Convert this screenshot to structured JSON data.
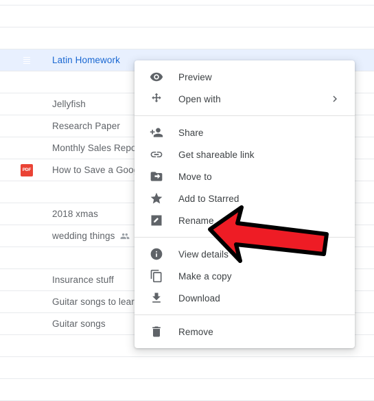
{
  "app": {
    "name": "Google Drive file list with context menu"
  },
  "colors": {
    "selected_row_bg": "#e8f0fe",
    "selected_row_text": "#1967d2",
    "row_text": "#5f6368",
    "menu_text": "#3c4043",
    "menu_icon": "#5f6368",
    "divider": "#e8eaed",
    "sheet_green": "#0f9d58",
    "doc_blue": "#4285f4",
    "slides_yellow": "#f4b400",
    "pdf_red": "#ea4335",
    "arrow_red": "#ee1c25",
    "arrow_outline": "#000000"
  },
  "file_list": {
    "rows": [
      {
        "icon": "sheets-file-icon",
        "icon_type": "sheet",
        "name": "",
        "selected": false,
        "partial": true,
        "shared": false
      },
      {
        "icon": "sheets-file-icon",
        "icon_type": "sheet",
        "name": "",
        "selected": false,
        "partial": false,
        "shared": false
      },
      {
        "icon": "sheets-file-icon",
        "icon_type": "sheet",
        "name": "",
        "selected": false,
        "partial": false,
        "shared": false
      },
      {
        "icon": "docs-file-icon",
        "icon_type": "doc",
        "name": "Latin Homework",
        "selected": true,
        "partial": false,
        "shared": false
      },
      {
        "icon": "sheets-file-icon",
        "icon_type": "sheet",
        "name": "",
        "selected": false,
        "partial": false,
        "shared": false
      },
      {
        "icon": "slides-file-icon",
        "icon_type": "slides",
        "name": "Jellyfish",
        "selected": false,
        "partial": false,
        "shared": false
      },
      {
        "icon": "docs-file-icon",
        "icon_type": "doc",
        "name": "Research Paper",
        "selected": false,
        "partial": false,
        "shared": false
      },
      {
        "icon": "sheets-file-icon",
        "icon_type": "sheet",
        "name": "Monthly Sales Report",
        "selected": false,
        "partial": false,
        "shared": false
      },
      {
        "icon": "pdf-file-icon",
        "icon_type": "pdf",
        "name": "How to Save a Google",
        "selected": false,
        "partial": false,
        "shared": false
      },
      {
        "icon": "docs-file-icon",
        "icon_type": "doc",
        "name": "",
        "selected": false,
        "partial": false,
        "shared": false
      },
      {
        "icon": "sheets-file-icon",
        "icon_type": "sheet",
        "name": "2018 xmas",
        "selected": false,
        "partial": false,
        "shared": false
      },
      {
        "icon": "sheets-file-icon",
        "icon_type": "sheet",
        "name": "wedding things",
        "selected": false,
        "partial": false,
        "shared": true
      },
      {
        "icon": "sheets-file-icon",
        "icon_type": "sheet",
        "name": "",
        "selected": false,
        "partial": false,
        "shared": false
      },
      {
        "icon": "sheets-file-icon",
        "icon_type": "sheet",
        "name": "Insurance stuff",
        "selected": false,
        "partial": false,
        "shared": false
      },
      {
        "icon": "sheets-file-icon",
        "icon_type": "sheet",
        "name": "Guitar songs to learn",
        "selected": false,
        "partial": false,
        "shared": false
      },
      {
        "icon": "sheets-file-icon",
        "icon_type": "sheet",
        "name": "Guitar songs",
        "selected": false,
        "partial": false,
        "shared": false
      },
      {
        "icon": "sheets-file-icon",
        "icon_type": "sheet",
        "name": "",
        "selected": false,
        "partial": false,
        "shared": false
      },
      {
        "icon": "sheets-file-icon",
        "icon_type": "sheet",
        "name": "",
        "selected": false,
        "partial": false,
        "shared": false
      },
      {
        "icon": "sheets-file-icon",
        "icon_type": "sheet",
        "name": "",
        "selected": false,
        "partial": false,
        "shared": false
      }
    ],
    "pdf_label": "PDF"
  },
  "context_menu": {
    "sections": [
      {
        "items": [
          {
            "label": "Preview",
            "icon": "eye-icon",
            "submenu": false
          },
          {
            "label": "Open with",
            "icon": "open-with-icon",
            "submenu": true
          }
        ]
      },
      {
        "items": [
          {
            "label": "Share",
            "icon": "add-person-icon",
            "submenu": false
          },
          {
            "label": "Get shareable link",
            "icon": "link-icon",
            "submenu": false
          },
          {
            "label": "Move to",
            "icon": "move-folder-icon",
            "submenu": false
          },
          {
            "label": "Add to Starred",
            "icon": "star-icon",
            "submenu": false
          },
          {
            "label": "Rename",
            "icon": "pencil-square-icon",
            "submenu": false
          }
        ]
      },
      {
        "items": [
          {
            "label": "View details",
            "icon": "info-icon",
            "submenu": false
          },
          {
            "label": "Make a copy",
            "icon": "copy-icon",
            "submenu": false
          },
          {
            "label": "Download",
            "icon": "download-icon",
            "submenu": false
          }
        ]
      },
      {
        "items": [
          {
            "label": "Remove",
            "icon": "trash-icon",
            "submenu": false
          }
        ]
      }
    ]
  },
  "annotation": {
    "arrow": {
      "name": "red-arrow-annotation",
      "points_to": "Rename",
      "direction": "left",
      "fill": "#ee1c25",
      "stroke": "#000000"
    }
  }
}
